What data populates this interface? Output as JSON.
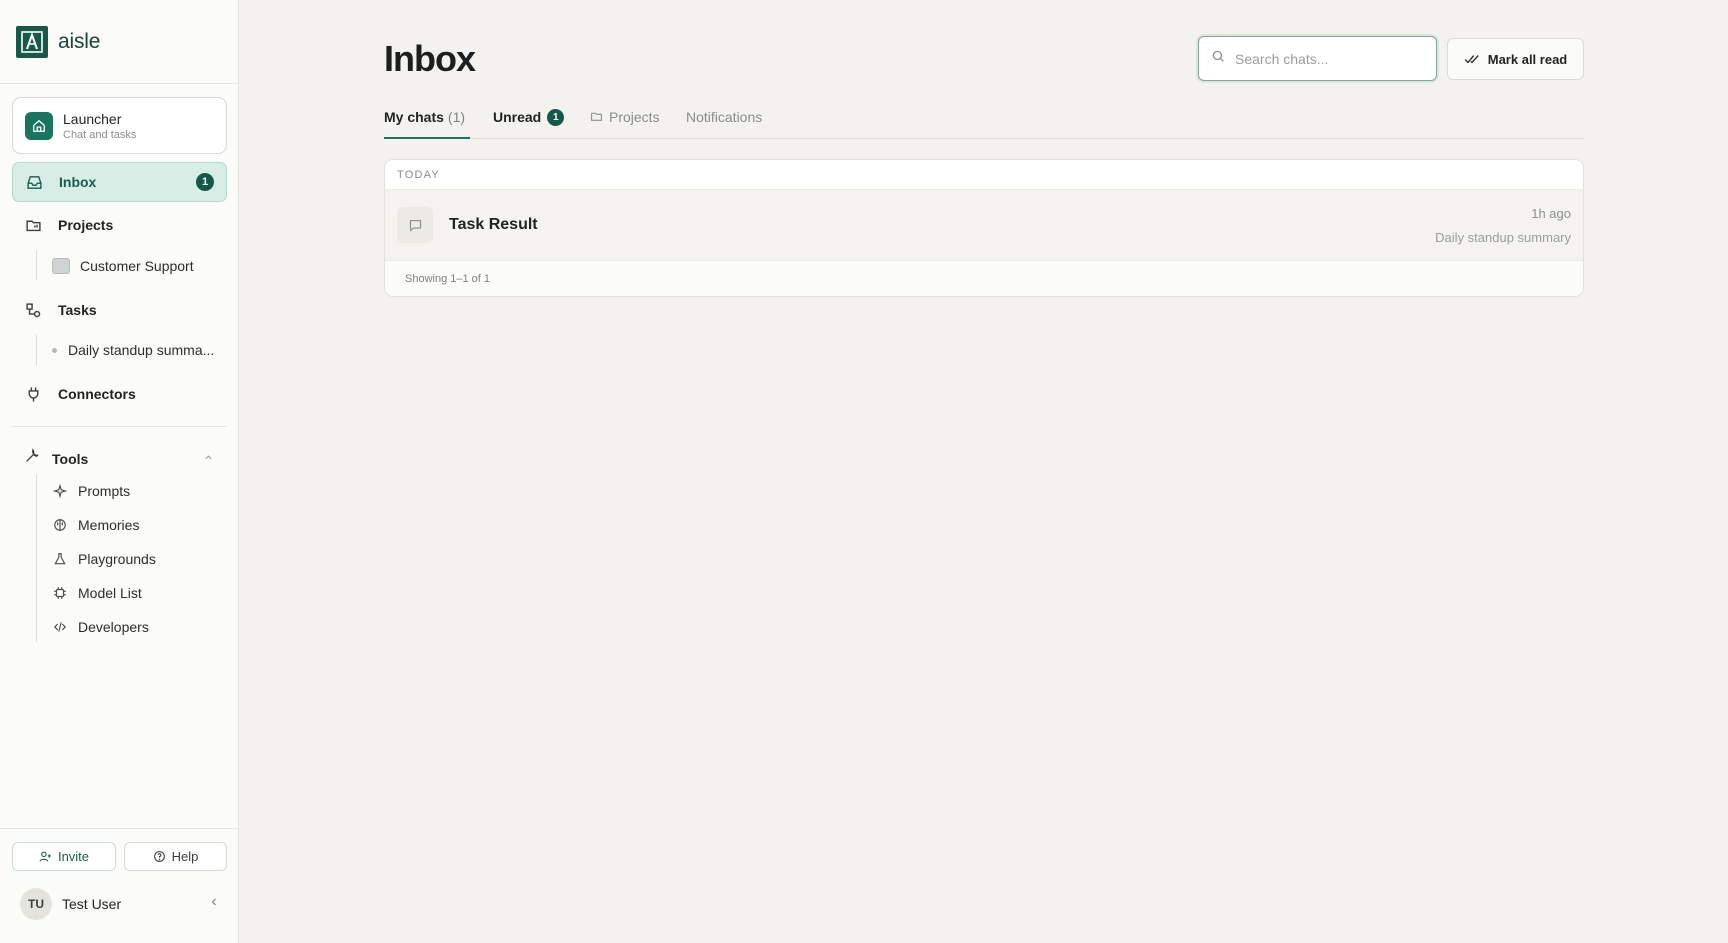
{
  "brand": {
    "name": "aisle"
  },
  "launcher": {
    "title": "Launcher",
    "subtitle": "Chat and tasks"
  },
  "nav": {
    "inbox": {
      "label": "Inbox",
      "badge": "1"
    },
    "projects": {
      "label": "Projects",
      "children": [
        "Customer Support"
      ]
    },
    "tasks": {
      "label": "Tasks",
      "children": [
        "Daily standup summa..."
      ]
    },
    "connectors": {
      "label": "Connectors"
    }
  },
  "tools": {
    "label": "Tools",
    "items": [
      "Prompts",
      "Memories",
      "Playgrounds",
      "Model List",
      "Developers"
    ]
  },
  "footer": {
    "invite_label": "Invite",
    "help_label": "Help",
    "user_initials": "TU",
    "user_name": "Test User"
  },
  "header": {
    "title": "Inbox",
    "search_placeholder": "Search chats...",
    "mark_all_label": "Mark all read"
  },
  "tabs": [
    {
      "label": "My chats",
      "count": "(1)"
    },
    {
      "label": "Unread",
      "badge": "1"
    },
    {
      "label": "Projects"
    },
    {
      "label": "Notifications"
    }
  ],
  "list": {
    "section": "TODAY",
    "rows": [
      {
        "title": "Task Result",
        "time": "1h ago",
        "subtitle": "Daily standup summary"
      }
    ],
    "footer": "Showing 1–1 of 1"
  },
  "colors": {
    "accent": "#16594a",
    "active_bg": "#d8ede6"
  }
}
